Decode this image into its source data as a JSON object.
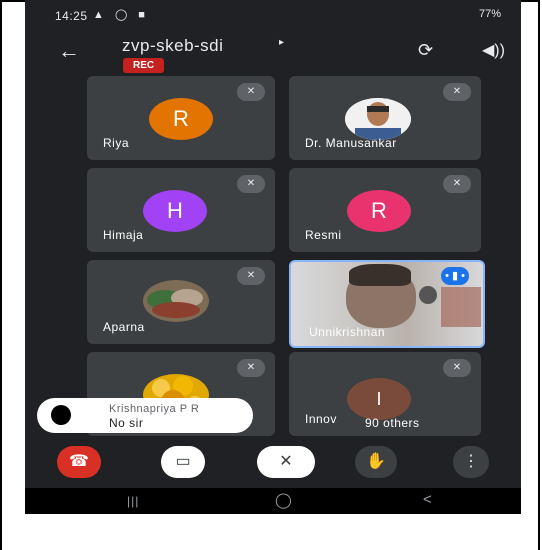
{
  "status": {
    "time": "14:25",
    "left_icons": "▲ ◯ ■",
    "right_text": "77%"
  },
  "meeting": {
    "code": "zvp-skeb-sdi",
    "rec": "REC"
  },
  "tiles": [
    {
      "name": "Riya",
      "initial": "R",
      "color": "#e37400"
    },
    {
      "name": "Dr. Manusankar",
      "initial": "",
      "color": "#ffffff"
    },
    {
      "name": "Himaja",
      "initial": "H",
      "color": "#a142f4"
    },
    {
      "name": "Resmi",
      "initial": "R",
      "color": "#e8336e"
    },
    {
      "name": "Aparna",
      "initial": "",
      "color": "#6b4f3a"
    },
    {
      "name": "Unnikrishnan",
      "initial": "",
      "color": "#8ab4f8"
    },
    {
      "name": "",
      "initial": "",
      "color": "#f2b705"
    },
    {
      "name": "Innov",
      "initial": "I",
      "color": "#7a4a3a"
    }
  ],
  "toast": {
    "sender": "Krishnapriya P R",
    "message": "No sir"
  },
  "others_label": "90 others",
  "controls": {
    "end": "#d93025",
    "camera": "#ffffff",
    "mic": "#ffffff",
    "hand": "#3c4043",
    "more": "#3c4043"
  },
  "icons": {
    "back": "←",
    "caret": "▸",
    "switch": "⟳",
    "speaker": "◀))",
    "mic_off": "✕",
    "end": "☎",
    "cam_off": "▭",
    "hand": "✋",
    "more": "⋮",
    "nav_recent": "|||",
    "nav_home": "◯",
    "nav_back": "<"
  }
}
